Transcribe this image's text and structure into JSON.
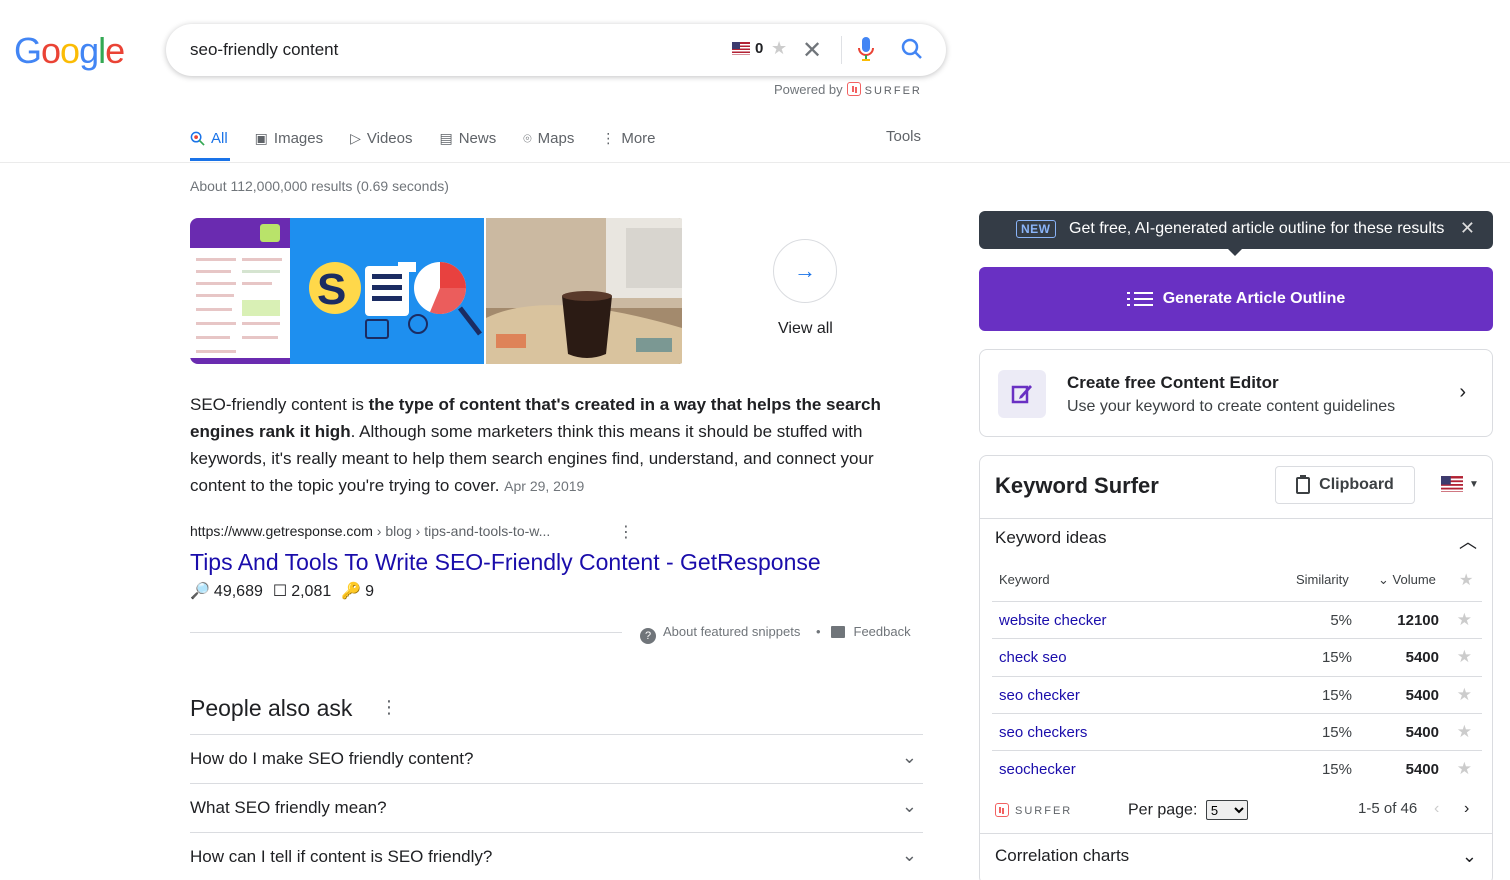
{
  "logo": {
    "letters": [
      "G",
      "o",
      "o",
      "g",
      "l",
      "e"
    ]
  },
  "search": {
    "query": "seo-friendly content",
    "keyword_count": "0",
    "powered_by": "Powered by",
    "powered_brand": "SURFER"
  },
  "tabs": [
    {
      "label": "All",
      "icon": "search-icon",
      "active": true
    },
    {
      "label": "Images",
      "icon": "image-icon"
    },
    {
      "label": "Videos",
      "icon": "video-icon"
    },
    {
      "label": "News",
      "icon": "news-icon"
    },
    {
      "label": "Maps",
      "icon": "map-pin-icon"
    },
    {
      "label": "More",
      "icon": "more-vert-icon"
    }
  ],
  "tools_label": "Tools",
  "result_stats": "About 112,000,000 results (0.69 seconds)",
  "view_all": "View all",
  "snippet": {
    "pre": "SEO-friendly content is ",
    "bold": "the type of content that's created in a way that helps the search engines rank it high",
    "post": ". Although some marketers think this means it should be stuffed with keywords, it's really meant to help them search engines find, understand, and connect your content to the topic you're trying to cover.",
    "date": "Apr 29, 2019"
  },
  "result": {
    "domain": "https://www.getresponse.com",
    "path": " › blog › tips-and-tools-to-w...",
    "title": "Tips And Tools To Write SEO-Friendly Content - GetResponse",
    "metric1": "49,689",
    "metric2": "2,081",
    "metric3": "9"
  },
  "about_snippets": "About featured snippets",
  "dot": "•",
  "feedback": "Feedback",
  "paa": {
    "title": "People also ask",
    "questions": [
      "How do I make SEO friendly content?",
      "What SEO friendly mean?",
      "How can I tell if content is SEO friendly?"
    ]
  },
  "surfer_panel": {
    "badge": "NEW",
    "tooltip": "Get free, AI-generated article outline for these results",
    "generate_label": "Generate Article Outline",
    "ce_title": "Create free Content Editor",
    "ce_sub": "Use your keyword to create content guidelines",
    "ks_title": "Keyword Surfer",
    "clipboard": "Clipboard",
    "ideas_title": "Keyword ideas",
    "columns": {
      "keyword": "Keyword",
      "similarity": "Similarity",
      "volume": "Volume"
    },
    "rows": [
      {
        "keyword": "website checker",
        "similarity": "5%",
        "volume": "12100"
      },
      {
        "keyword": "check seo",
        "similarity": "15%",
        "volume": "5400"
      },
      {
        "keyword": "seo checker",
        "similarity": "15%",
        "volume": "5400"
      },
      {
        "keyword": "seo checkers",
        "similarity": "15%",
        "volume": "5400"
      },
      {
        "keyword": "seochecker",
        "similarity": "15%",
        "volume": "5400"
      }
    ],
    "brand": "SURFER",
    "per_page_label": "Per page:",
    "per_page_value": "5",
    "pager": "1-5 of 46",
    "correlation": "Correlation charts"
  },
  "colors": {
    "accent": "#1a73e8",
    "surfer_purple": "#6930c3",
    "link": "#1a0dab"
  }
}
